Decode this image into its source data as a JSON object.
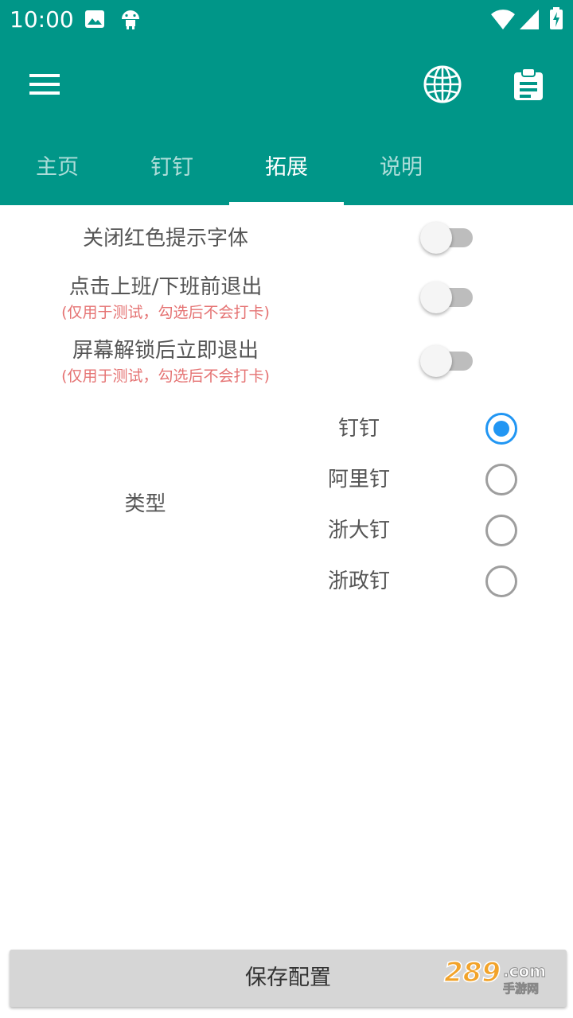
{
  "status_bar": {
    "time": "10:00",
    "icons": [
      "image-icon",
      "android-icon",
      "wifi-icon",
      "signal-icon",
      "battery-charging-icon"
    ]
  },
  "toolbar": {
    "icons": [
      "menu-icon",
      "globe-icon",
      "clipboard-icon"
    ]
  },
  "tabs": [
    {
      "label": "主页",
      "active": false
    },
    {
      "label": "钉钉",
      "active": false
    },
    {
      "label": "拓展",
      "active": true
    },
    {
      "label": "说明",
      "active": false
    }
  ],
  "settings": [
    {
      "label": "关闭红色提示字体",
      "sub": "",
      "enabled": false
    },
    {
      "label": "点击上班/下班前退出",
      "sub": "(仅用于测试，勾选后不会打卡)",
      "enabled": false
    },
    {
      "label": "屏幕解锁后立即退出",
      "sub": "(仅用于测试，勾选后不会打卡)",
      "enabled": false
    }
  ],
  "type_group": {
    "label": "类型",
    "options": [
      {
        "label": "钉钉",
        "checked": true
      },
      {
        "label": "阿里钉",
        "checked": false
      },
      {
        "label": "浙大钉",
        "checked": false
      },
      {
        "label": "浙政钉",
        "checked": false
      }
    ]
  },
  "save_button": {
    "label": "保存配置"
  },
  "colors": {
    "primary": "#009688",
    "radio_checked": "#2196f3",
    "hint_red": "#e57373",
    "button_bg": "#d6d6d6"
  },
  "watermark": {
    "text": "289.com 手游网"
  }
}
